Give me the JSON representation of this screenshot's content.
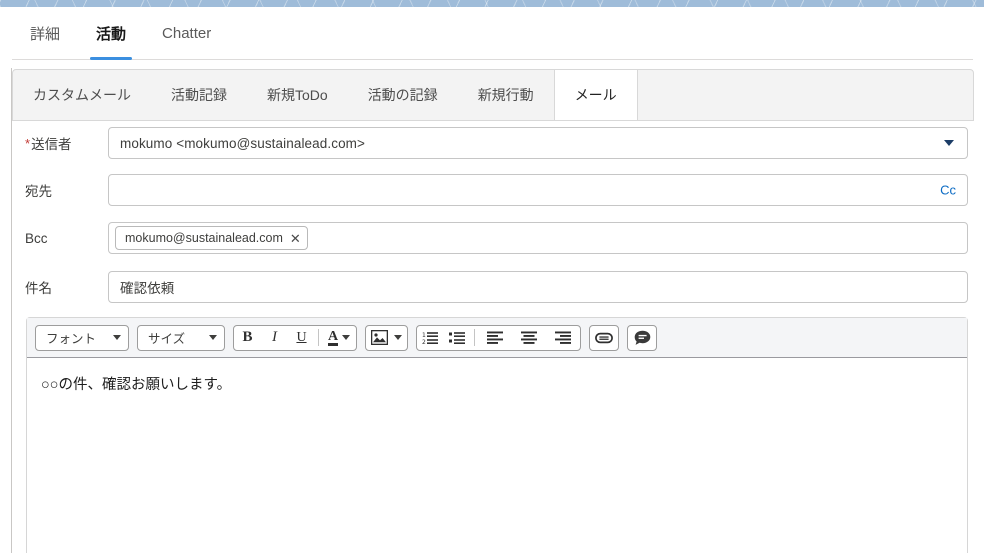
{
  "main_tabs": [
    {
      "label": "詳細",
      "active": false
    },
    {
      "label": "活動",
      "active": true
    },
    {
      "label": "Chatter",
      "active": false
    }
  ],
  "sub_tabs": [
    {
      "label": "カスタムメール",
      "active": false
    },
    {
      "label": "活動記録",
      "active": false
    },
    {
      "label": "新規ToDo",
      "active": false
    },
    {
      "label": "活動の記録",
      "active": false
    },
    {
      "label": "新規行動",
      "active": false
    },
    {
      "label": "メール",
      "active": true
    }
  ],
  "form": {
    "from": {
      "label": "送信者",
      "required_marker": "*",
      "value": "mokumo <mokumo@sustainalead.com>",
      "dropdown_icon": "caret-down-icon"
    },
    "to": {
      "label": "宛先",
      "value": "",
      "placeholder": "",
      "cc_link": "Cc"
    },
    "bcc": {
      "label": "Bcc",
      "value": "",
      "placeholder": "",
      "chips": [
        {
          "text": "mokumo@sustainalead.com",
          "remove_icon": "✕"
        }
      ]
    },
    "subject": {
      "label": "件名",
      "value": "確認依頼",
      "placeholder": ""
    }
  },
  "editor": {
    "font_select": {
      "label": "フォント"
    },
    "size_select": {
      "label": "サイズ"
    },
    "buttons": {
      "bold": "B",
      "italic": "I",
      "underline": "U",
      "text_color": "A"
    },
    "body_text": "○○の件、確認お願いします。"
  },
  "colors": {
    "accent_blue": "#3b8fe0",
    "link_blue": "#0b6bc4",
    "required_red": "#c23934",
    "toolbar_bg": "#f4f5f7",
    "subtab_bg": "#f3f3f3",
    "border_gray": "#c6c6c6",
    "top_band": "#9fbcd9"
  }
}
